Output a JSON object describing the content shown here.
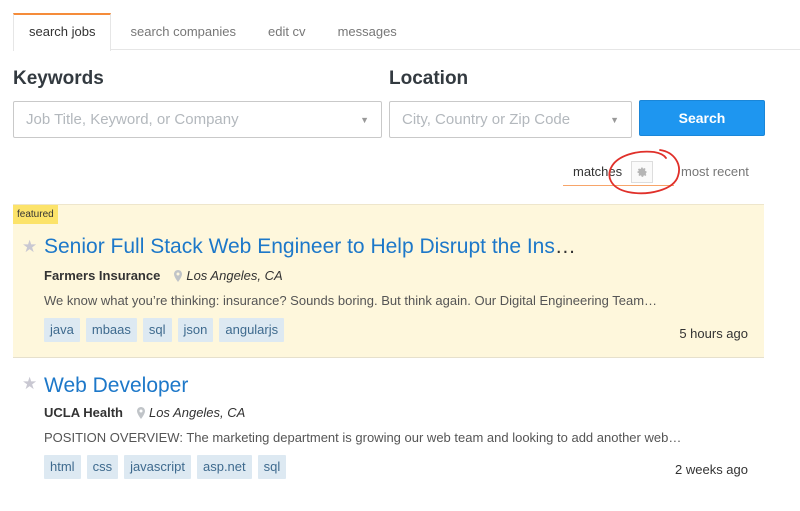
{
  "tabs": [
    {
      "label": "search jobs",
      "active": true
    },
    {
      "label": "search companies",
      "active": false
    },
    {
      "label": "edit cv",
      "active": false
    },
    {
      "label": "messages",
      "active": false
    }
  ],
  "search": {
    "keywords_label": "Keywords",
    "keywords_placeholder": "Job Title, Keyword, or Company",
    "keywords_value": "",
    "location_label": "Location",
    "location_placeholder": "City, Country or Zip Code",
    "location_value": "",
    "search_button": "Search"
  },
  "sort": {
    "matches_label": "matches",
    "most_recent_label": "most recent",
    "active": "matches",
    "settings_icon": "gear-icon"
  },
  "colors": {
    "accent_tab": "#f58c3a",
    "primary_button": "#1e96f0",
    "link": "#1d78c9",
    "featured_bg": "#fef7dc",
    "featured_badge": "#fce36a",
    "tag_bg": "#dde9f2",
    "annotation": "#e0302a"
  },
  "jobs": [
    {
      "featured": true,
      "badge": "featured",
      "title": "Senior Full Stack Web Engineer to Help Disrupt the Ins",
      "title_ellipsis": "…",
      "company": "Farmers Insurance",
      "location": "Los Angeles, CA",
      "description": "We know what you’re thinking: insurance? Sounds boring. But think again. Our Digital Engineering Team…",
      "tags": [
        "java",
        "mbaas",
        "sql",
        "json",
        "angularjs"
      ],
      "posted": "5 hours ago"
    },
    {
      "featured": false,
      "title": "Web Developer",
      "title_ellipsis": "",
      "company": "UCLA Health",
      "location": "Los Angeles, CA",
      "description": "POSITION OVERVIEW: The marketing department is growing our web team and looking to add another web…",
      "tags": [
        "html",
        "css",
        "javascript",
        "asp.net",
        "sql"
      ],
      "posted": "2 weeks ago"
    }
  ]
}
